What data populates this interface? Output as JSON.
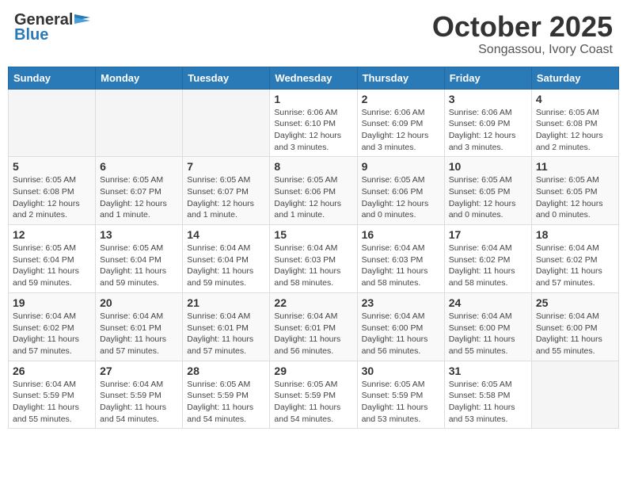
{
  "header": {
    "logo_general": "General",
    "logo_blue": "Blue",
    "title": "October 2025",
    "subtitle": "Songassou, Ivory Coast"
  },
  "days_of_week": [
    "Sunday",
    "Monday",
    "Tuesday",
    "Wednesday",
    "Thursday",
    "Friday",
    "Saturday"
  ],
  "weeks": [
    [
      {
        "day": "",
        "empty": true
      },
      {
        "day": "",
        "empty": true
      },
      {
        "day": "",
        "empty": true
      },
      {
        "day": "1",
        "sunrise": "6:06 AM",
        "sunset": "6:10 PM",
        "daylight": "12 hours and 3 minutes."
      },
      {
        "day": "2",
        "sunrise": "6:06 AM",
        "sunset": "6:09 PM",
        "daylight": "12 hours and 3 minutes."
      },
      {
        "day": "3",
        "sunrise": "6:06 AM",
        "sunset": "6:09 PM",
        "daylight": "12 hours and 3 minutes."
      },
      {
        "day": "4",
        "sunrise": "6:05 AM",
        "sunset": "6:08 PM",
        "daylight": "12 hours and 2 minutes."
      }
    ],
    [
      {
        "day": "5",
        "sunrise": "6:05 AM",
        "sunset": "6:08 PM",
        "daylight": "12 hours and 2 minutes."
      },
      {
        "day": "6",
        "sunrise": "6:05 AM",
        "sunset": "6:07 PM",
        "daylight": "12 hours and 1 minute."
      },
      {
        "day": "7",
        "sunrise": "6:05 AM",
        "sunset": "6:07 PM",
        "daylight": "12 hours and 1 minute."
      },
      {
        "day": "8",
        "sunrise": "6:05 AM",
        "sunset": "6:06 PM",
        "daylight": "12 hours and 1 minute."
      },
      {
        "day": "9",
        "sunrise": "6:05 AM",
        "sunset": "6:06 PM",
        "daylight": "12 hours and 0 minutes."
      },
      {
        "day": "10",
        "sunrise": "6:05 AM",
        "sunset": "6:05 PM",
        "daylight": "12 hours and 0 minutes."
      },
      {
        "day": "11",
        "sunrise": "6:05 AM",
        "sunset": "6:05 PM",
        "daylight": "12 hours and 0 minutes."
      }
    ],
    [
      {
        "day": "12",
        "sunrise": "6:05 AM",
        "sunset": "6:04 PM",
        "daylight": "11 hours and 59 minutes."
      },
      {
        "day": "13",
        "sunrise": "6:05 AM",
        "sunset": "6:04 PM",
        "daylight": "11 hours and 59 minutes."
      },
      {
        "day": "14",
        "sunrise": "6:04 AM",
        "sunset": "6:04 PM",
        "daylight": "11 hours and 59 minutes."
      },
      {
        "day": "15",
        "sunrise": "6:04 AM",
        "sunset": "6:03 PM",
        "daylight": "11 hours and 58 minutes."
      },
      {
        "day": "16",
        "sunrise": "6:04 AM",
        "sunset": "6:03 PM",
        "daylight": "11 hours and 58 minutes."
      },
      {
        "day": "17",
        "sunrise": "6:04 AM",
        "sunset": "6:02 PM",
        "daylight": "11 hours and 58 minutes."
      },
      {
        "day": "18",
        "sunrise": "6:04 AM",
        "sunset": "6:02 PM",
        "daylight": "11 hours and 57 minutes."
      }
    ],
    [
      {
        "day": "19",
        "sunrise": "6:04 AM",
        "sunset": "6:02 PM",
        "daylight": "11 hours and 57 minutes."
      },
      {
        "day": "20",
        "sunrise": "6:04 AM",
        "sunset": "6:01 PM",
        "daylight": "11 hours and 57 minutes."
      },
      {
        "day": "21",
        "sunrise": "6:04 AM",
        "sunset": "6:01 PM",
        "daylight": "11 hours and 57 minutes."
      },
      {
        "day": "22",
        "sunrise": "6:04 AM",
        "sunset": "6:01 PM",
        "daylight": "11 hours and 56 minutes."
      },
      {
        "day": "23",
        "sunrise": "6:04 AM",
        "sunset": "6:00 PM",
        "daylight": "11 hours and 56 minutes."
      },
      {
        "day": "24",
        "sunrise": "6:04 AM",
        "sunset": "6:00 PM",
        "daylight": "11 hours and 55 minutes."
      },
      {
        "day": "25",
        "sunrise": "6:04 AM",
        "sunset": "6:00 PM",
        "daylight": "11 hours and 55 minutes."
      }
    ],
    [
      {
        "day": "26",
        "sunrise": "6:04 AM",
        "sunset": "5:59 PM",
        "daylight": "11 hours and 55 minutes."
      },
      {
        "day": "27",
        "sunrise": "6:04 AM",
        "sunset": "5:59 PM",
        "daylight": "11 hours and 54 minutes."
      },
      {
        "day": "28",
        "sunrise": "6:05 AM",
        "sunset": "5:59 PM",
        "daylight": "11 hours and 54 minutes."
      },
      {
        "day": "29",
        "sunrise": "6:05 AM",
        "sunset": "5:59 PM",
        "daylight": "11 hours and 54 minutes."
      },
      {
        "day": "30",
        "sunrise": "6:05 AM",
        "sunset": "5:59 PM",
        "daylight": "11 hours and 53 minutes."
      },
      {
        "day": "31",
        "sunrise": "6:05 AM",
        "sunset": "5:58 PM",
        "daylight": "11 hours and 53 minutes."
      },
      {
        "day": "",
        "empty": true
      }
    ]
  ]
}
